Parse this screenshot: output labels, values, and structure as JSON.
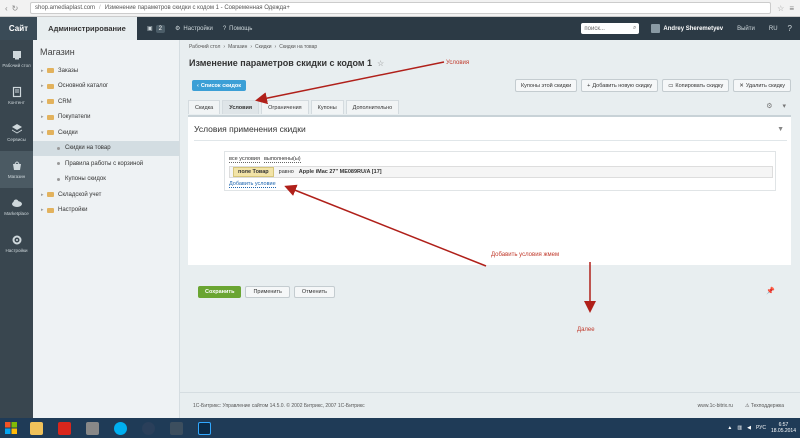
{
  "browser": {
    "url": "shop.amediaplast.com",
    "title": "Изменение параметров скидки с кодом 1 - Современная Одежда+"
  },
  "header": {
    "site_tab": "Сайт",
    "admin_tab": "Администрирование",
    "notifications_count": "2",
    "settings": "Настройки",
    "help": "Помощь",
    "search_placeholder": "поиск...",
    "user": "Andrey Sheremetyev",
    "logout": "Выйти",
    "lang": "RU",
    "help_icon": "?"
  },
  "iconbar": [
    {
      "label": "Рабочий стол",
      "icon": "desktop-icon"
    },
    {
      "label": "Контент",
      "icon": "content-icon"
    },
    {
      "label": "Сервисы",
      "icon": "services-icon"
    },
    {
      "label": "Магазин",
      "icon": "shop-icon"
    },
    {
      "label": "Marketplace",
      "icon": "cloud-icon"
    },
    {
      "label": "Настройки",
      "icon": "gear-icon"
    }
  ],
  "submenu": {
    "title": "Магазин",
    "items": [
      {
        "label": "Заказы"
      },
      {
        "label": "Основной каталог"
      },
      {
        "label": "CRM"
      },
      {
        "label": "Покупатели"
      },
      {
        "label": "Скидки"
      },
      {
        "label": "Скидки на товар"
      },
      {
        "label": "Правила работы с корзиной"
      },
      {
        "label": "Купоны скидок"
      },
      {
        "label": "Складской учет"
      },
      {
        "label": "Настройки"
      }
    ]
  },
  "breadcrumb": [
    "Рабочий стол",
    "Магазин",
    "Скидки",
    "Скидки на товар"
  ],
  "page_title": "Изменение параметров скидки с кодом 1",
  "list_button": "Список скидок",
  "top_buttons": {
    "coupons": "Купоны этой скидки",
    "add": "Добавить новую скидку",
    "copy": "Копировать скидку",
    "delete": "Удалить скидку"
  },
  "tabs": [
    "Скидка",
    "Условия",
    "Ограничения",
    "Купоны",
    "Дополнительно"
  ],
  "panel": {
    "title": "Условия применения скидки",
    "all_conditions": "все условия",
    "fulfilled": "выполнены(ы)",
    "field": "поле Товар",
    "operator": "равно",
    "value": "Apple iMac 27\" ME089RU/A [17]",
    "add_condition": "Добавить условие"
  },
  "actions": {
    "save": "Сохранить",
    "apply": "Применить",
    "cancel": "Отменить"
  },
  "annotations": {
    "conditions": "Условия",
    "add_conditions": "Добавить условия жмем",
    "next": "Далее"
  },
  "footer": {
    "left": "1С-Битрикс: Управление сайтом 14.5.0. © 2002 Битрикс, 2007 1С-Битрикс",
    "link": "www.1c-bitrix.ru",
    "support": "Техподдержка"
  },
  "taskbar": {
    "lang": "РУС",
    "time": "6:57",
    "date": "18.05.2014"
  },
  "colors": {
    "accent_blue": "#3b9fd6",
    "save_green": "#6aa532",
    "annotation_red": "#c0392b"
  }
}
